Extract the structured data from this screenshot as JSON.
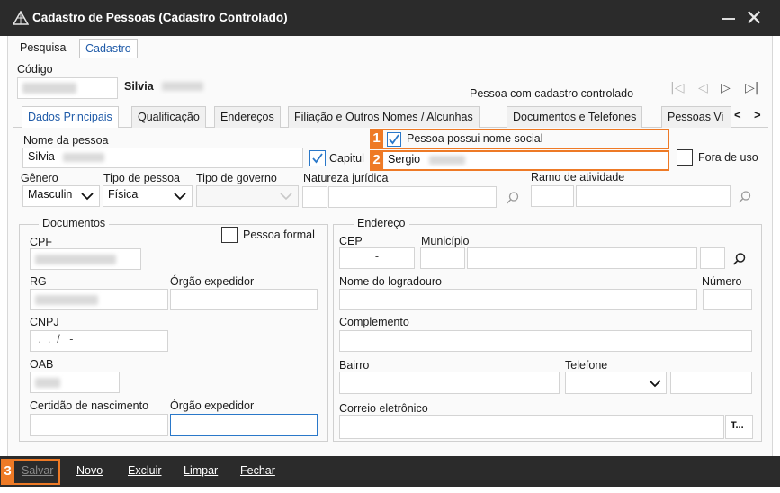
{
  "window": {
    "title": "Cadastro de Pessoas (Cadastro Controlado)",
    "minimize_glyph": "—",
    "close_glyph": "✕"
  },
  "top_tabs": [
    {
      "label": "Pesquisa"
    },
    {
      "label": "Cadastro"
    }
  ],
  "header": {
    "codigo_label": "Código",
    "person_name": "Silvia",
    "controlled_text": "Pessoa com cadastro controlado"
  },
  "nav_arrows": [
    "|◁",
    "◁",
    "▷",
    "▷|"
  ],
  "inner_tabs": [
    {
      "label": "Dados Principais"
    },
    {
      "label": "Qualificação"
    },
    {
      "label": "Endereços"
    },
    {
      "label": "Filiação e Outros Nomes / Alcunhas"
    },
    {
      "label": "Documentos e Telefones"
    },
    {
      "label": "Pessoas Vi"
    }
  ],
  "tab_scroll": {
    "left": "<",
    "right": ">"
  },
  "main": {
    "nome_label": "Nome da pessoa",
    "nome_value": "Silvia",
    "capitular_label": "Capitul",
    "nome_social_check_label": "Pessoa possui nome social",
    "nome_social_value": "Sergio",
    "fora_de_uso_label": "Fora de uso",
    "genero_label": "Gênero",
    "genero_value": "Masculin",
    "tipo_pessoa_label": "Tipo de pessoa",
    "tipo_pessoa_value": "Física",
    "tipo_governo_label": "Tipo de governo",
    "natureza_label": "Natureza jurídica",
    "ramo_label": "Ramo de atividade"
  },
  "documentos": {
    "title": "Documentos",
    "pessoa_formal_label": "Pessoa formal",
    "cpf_label": "CPF",
    "rg_label": "RG",
    "orgao_label": "Órgão expedidor",
    "cnpj_label": "CNPJ",
    "cnpj_mask": " .  .  /   -",
    "oab_label": "OAB",
    "certidao_label": "Certidão de nascimento",
    "orgao2_label": "Órgão expedidor"
  },
  "endereco": {
    "title": "Endereço",
    "cep_label": "CEP",
    "cep_mask": "-",
    "municipio_label": "Município",
    "logradouro_label": "Nome do logradouro",
    "numero_label": "Número",
    "complemento_label": "Complemento",
    "bairro_label": "Bairro",
    "telefone_label": "Telefone",
    "correio_label": "Correio eletrônico",
    "correio_btn": "T..."
  },
  "annotations": [
    "1",
    "2",
    "3"
  ],
  "toolbar": {
    "salvar": "Salvar",
    "novo": "Novo",
    "excluir": "Excluir",
    "limpar": "Limpar",
    "fechar": "Fechar"
  },
  "colors": {
    "titlebar": "#2b2b2b",
    "accent": "#1e5aa8",
    "annotation": "#ee7a26"
  }
}
